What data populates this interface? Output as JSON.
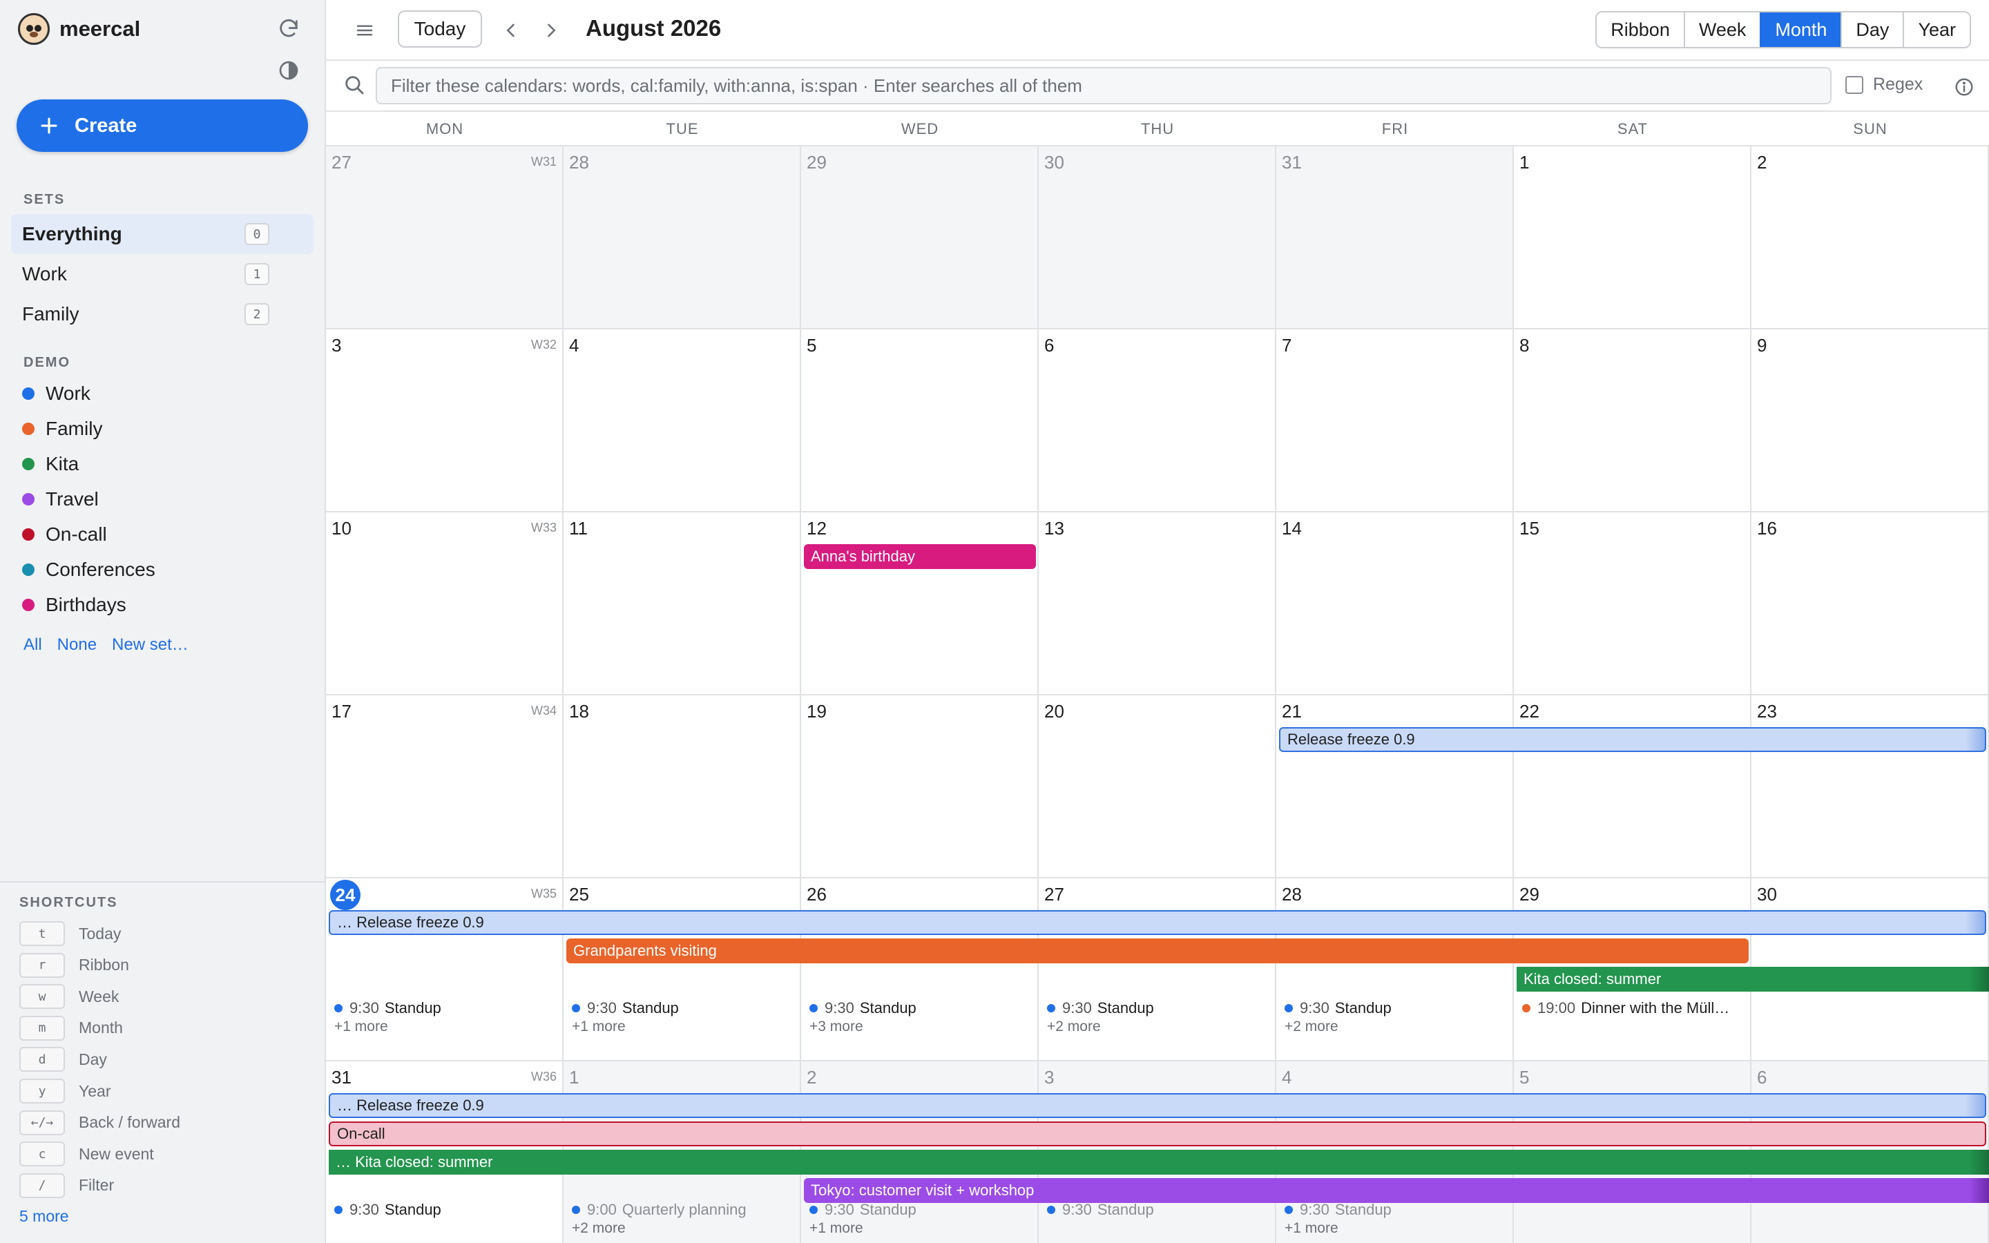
{
  "app": {
    "name": "meercal",
    "create_label": "Create"
  },
  "sidebar": {
    "sets_label": "SETS",
    "sets": [
      {
        "label": "Everything",
        "count": "0",
        "active": true
      },
      {
        "label": "Work",
        "count": "1",
        "active": false
      },
      {
        "label": "Family",
        "count": "2",
        "active": false
      }
    ],
    "demo_label": "DEMO",
    "calendars": [
      {
        "label": "Work",
        "color": "#1f6fe8"
      },
      {
        "label": "Family",
        "color": "#e9642b"
      },
      {
        "label": "Kita",
        "color": "#23954e"
      },
      {
        "label": "Travel",
        "color": "#9b4be6"
      },
      {
        "label": "On-call",
        "color": "#c0112b"
      },
      {
        "label": "Conferences",
        "color": "#1a8fb0"
      },
      {
        "label": "Birthdays",
        "color": "#d81b7e"
      }
    ],
    "links": {
      "all": "All",
      "none": "None",
      "new_set": "New set…"
    },
    "shortcuts_label": "SHORTCUTS",
    "shortcuts": [
      {
        "key": "t",
        "label": "Today"
      },
      {
        "key": "r",
        "label": "Ribbon"
      },
      {
        "key": "w",
        "label": "Week"
      },
      {
        "key": "m",
        "label": "Month"
      },
      {
        "key": "d",
        "label": "Day"
      },
      {
        "key": "y",
        "label": "Year"
      },
      {
        "key": "←/→",
        "label": "Back / forward"
      },
      {
        "key": "c",
        "label": "New event"
      },
      {
        "key": "/",
        "label": "Filter"
      }
    ],
    "more_shortcuts": "5 more"
  },
  "toolbar": {
    "today_label": "Today",
    "title": "August 2026",
    "views": [
      {
        "label": "Ribbon",
        "active": false
      },
      {
        "label": "Week",
        "active": false
      },
      {
        "label": "Month",
        "active": true
      },
      {
        "label": "Day",
        "active": false
      },
      {
        "label": "Year",
        "active": false
      }
    ]
  },
  "filter": {
    "placeholder": "Filter these calendars: words, cal:family, with:anna, is:span · Enter searches all of them",
    "regex_label": "Regex"
  },
  "calendar": {
    "weekdays": [
      "MON",
      "TUE",
      "WED",
      "THU",
      "FRI",
      "SAT",
      "SUN"
    ],
    "today_week": 4,
    "today_col": 0,
    "weeks": [
      {
        "label": "W31",
        "days": [
          {
            "n": "27",
            "other": true
          },
          {
            "n": "28",
            "other": true
          },
          {
            "n": "29",
            "other": true
          },
          {
            "n": "30",
            "other": true
          },
          {
            "n": "31",
            "other": true
          },
          {
            "n": "1",
            "other": false
          },
          {
            "n": "2",
            "other": false
          }
        ]
      },
      {
        "label": "W32",
        "days": [
          {
            "n": "3",
            "other": false
          },
          {
            "n": "4",
            "other": false
          },
          {
            "n": "5",
            "other": false
          },
          {
            "n": "6",
            "other": false
          },
          {
            "n": "7",
            "other": false
          },
          {
            "n": "8",
            "other": false
          },
          {
            "n": "9",
            "other": false
          }
        ]
      },
      {
        "label": "W33",
        "days": [
          {
            "n": "10",
            "other": false
          },
          {
            "n": "11",
            "other": false
          },
          {
            "n": "12",
            "other": false
          },
          {
            "n": "13",
            "other": false
          },
          {
            "n": "14",
            "other": false
          },
          {
            "n": "15",
            "other": false
          },
          {
            "n": "16",
            "other": false
          }
        ]
      },
      {
        "label": "W34",
        "days": [
          {
            "n": "17",
            "other": false
          },
          {
            "n": "18",
            "other": false
          },
          {
            "n": "19",
            "other": false
          },
          {
            "n": "20",
            "other": false
          },
          {
            "n": "21",
            "other": false
          },
          {
            "n": "22",
            "other": false
          },
          {
            "n": "23",
            "other": false
          }
        ]
      },
      {
        "label": "W35",
        "days": [
          {
            "n": "24",
            "other": false
          },
          {
            "n": "25",
            "other": false
          },
          {
            "n": "26",
            "other": false
          },
          {
            "n": "27",
            "other": false
          },
          {
            "n": "28",
            "other": false
          },
          {
            "n": "29",
            "other": false
          },
          {
            "n": "30",
            "other": false
          }
        ]
      },
      {
        "label": "W36",
        "days": [
          {
            "n": "31",
            "other": false
          },
          {
            "n": "1",
            "other": true
          },
          {
            "n": "2",
            "other": true
          },
          {
            "n": "3",
            "other": true
          },
          {
            "n": "4",
            "other": true
          },
          {
            "n": "5",
            "other": true
          },
          {
            "n": "6",
            "other": true
          }
        ]
      }
    ],
    "spans": [
      {
        "week": 2,
        "lane": 0,
        "start": 2,
        "end": 2,
        "title": "Anna's birthday",
        "kind": "birthday"
      },
      {
        "week": 3,
        "lane": 0,
        "start": 4,
        "end": 6,
        "title": "Release freeze 0.9",
        "kind": "freeze"
      },
      {
        "week": 4,
        "lane": 0,
        "start": 0,
        "end": 6,
        "title": "… Release freeze 0.9",
        "kind": "freeze"
      },
      {
        "week": 4,
        "lane": 1,
        "start": 1,
        "end": 5,
        "title": "Grandparents visiting",
        "kind": "grand"
      },
      {
        "week": 4,
        "lane": 2,
        "start": 5,
        "end": 6,
        "title": "Kita closed: summer",
        "kind": "kita"
      },
      {
        "week": 5,
        "lane": 0,
        "start": 0,
        "end": 6,
        "title": "… Release freeze 0.9",
        "kind": "freeze"
      },
      {
        "week": 5,
        "lane": 1,
        "start": 0,
        "end": 6,
        "title": "On-call",
        "kind": "oncall"
      },
      {
        "week": 5,
        "lane": 2,
        "start": 0,
        "end": 6,
        "title": "… Kita closed: summer",
        "kind": "kita"
      },
      {
        "week": 5,
        "lane": 3,
        "start": 2,
        "end": 6,
        "title": "Tokyo: customer visit + workshop",
        "kind": "tokyo"
      }
    ],
    "timed": [
      {
        "week": 4,
        "col": 0,
        "time": "9:30",
        "title": "Standup",
        "color": "#1f6fe8",
        "more": "+1 more"
      },
      {
        "week": 4,
        "col": 1,
        "time": "9:30",
        "title": "Standup",
        "color": "#1f6fe8",
        "more": "+1 more"
      },
      {
        "week": 4,
        "col": 2,
        "time": "9:30",
        "title": "Standup",
        "color": "#1f6fe8",
        "more": "+3 more"
      },
      {
        "week": 4,
        "col": 3,
        "time": "9:30",
        "title": "Standup",
        "color": "#1f6fe8",
        "more": "+2 more"
      },
      {
        "week": 4,
        "col": 4,
        "time": "9:30",
        "title": "Standup",
        "color": "#1f6fe8",
        "more": "+2 more"
      },
      {
        "week": 4,
        "col": 5,
        "time": "19:00",
        "title": "Dinner with the Müll…",
        "color": "#e9642b",
        "more": ""
      },
      {
        "week": 5,
        "col": 0,
        "time": "9:30",
        "title": "Standup",
        "color": "#1f6fe8",
        "more": "",
        "faded": false
      },
      {
        "week": 5,
        "col": 1,
        "time": "9:00",
        "title": "Quarterly planning",
        "color": "#1f6fe8",
        "more": "+2 more",
        "faded": true
      },
      {
        "week": 5,
        "col": 2,
        "time": "9:30",
        "title": "Standup",
        "color": "#1f6fe8",
        "more": "+1 more",
        "faded": true
      },
      {
        "week": 5,
        "col": 3,
        "time": "9:30",
        "title": "Standup",
        "color": "#1f6fe8",
        "more": "",
        "faded": true
      },
      {
        "week": 5,
        "col": 4,
        "time": "9:30",
        "title": "Standup",
        "color": "#1f6fe8",
        "more": "+1 more",
        "faded": true
      }
    ]
  }
}
